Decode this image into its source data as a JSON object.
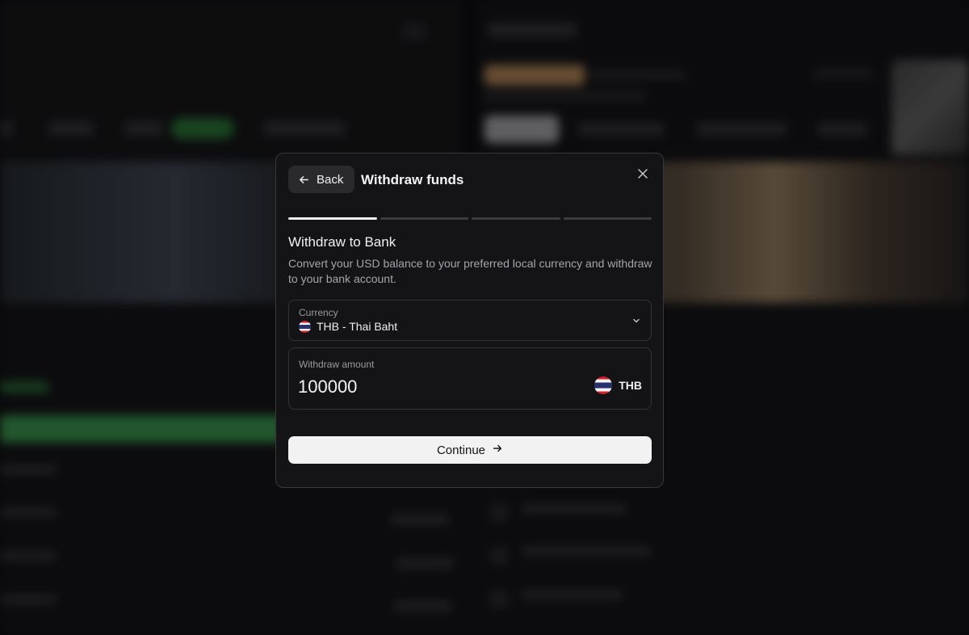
{
  "modal": {
    "back_label": "Back",
    "title": "Withdraw funds",
    "steps_total": 4,
    "steps_active": 1
  },
  "section": {
    "title": "Withdraw to Bank",
    "description": "Convert your USD balance to your preferred local currency and withdraw to your bank account."
  },
  "currency": {
    "label": "Currency",
    "value": "THB - Thai Baht",
    "flag_icon": "thailand-flag-icon"
  },
  "amount": {
    "label": "Withdraw amount",
    "value": "100000",
    "currency_code": "THB"
  },
  "continue_label": "Continue",
  "colors": {
    "modal_bg": "#141416",
    "accent_green": "#43b85a",
    "button_light": "#f2f2f3"
  }
}
